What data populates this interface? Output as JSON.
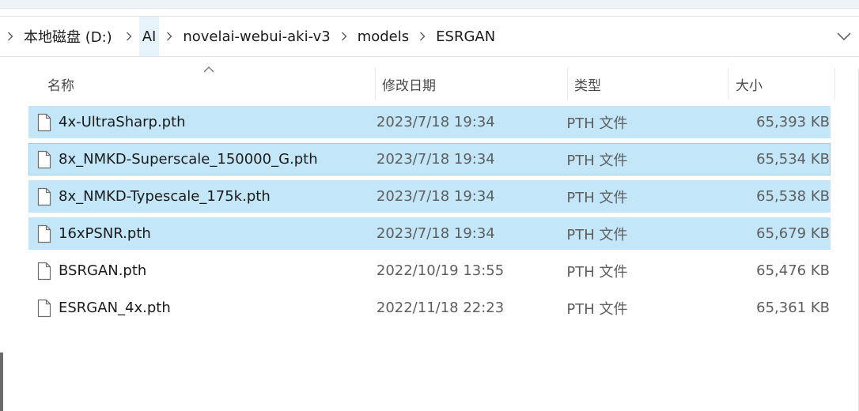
{
  "breadcrumb": {
    "items": [
      {
        "label": "本地磁盘 (D:)"
      },
      {
        "label": "AI"
      },
      {
        "label": "novelai-webui-aki-v3"
      },
      {
        "label": "models"
      },
      {
        "label": "ESRGAN"
      }
    ],
    "separator_icon": "chevron-right-icon",
    "dropdown_icon": "chevron-down-icon"
  },
  "columns": {
    "name": "名称",
    "date": "修改日期",
    "type": "类型",
    "size": "大小",
    "sort_icon": "sort-ascending-icon"
  },
  "files": [
    {
      "name": "4x-UltraSharp.pth",
      "date": "2023/7/18 19:34",
      "type": "PTH 文件",
      "size": "65,393 KB",
      "selected": true,
      "focused": false
    },
    {
      "name": "8x_NMKD-Superscale_150000_G.pth",
      "date": "2023/7/18 19:34",
      "type": "PTH 文件",
      "size": "65,534 KB",
      "selected": true,
      "focused": true
    },
    {
      "name": "8x_NMKD-Typescale_175k.pth",
      "date": "2023/7/18 19:34",
      "type": "PTH 文件",
      "size": "65,538 KB",
      "selected": true,
      "focused": false
    },
    {
      "name": "16xPSNR.pth",
      "date": "2023/7/18 19:34",
      "type": "PTH 文件",
      "size": "65,679 KB",
      "selected": true,
      "focused": false
    },
    {
      "name": "BSRGAN.pth",
      "date": "2022/10/19 13:55",
      "type": "PTH 文件",
      "size": "65,476 KB",
      "selected": false,
      "focused": false
    },
    {
      "name": "ESRGAN_4x.pth",
      "date": "2022/11/18 22:23",
      "type": "PTH 文件",
      "size": "65,361 KB",
      "selected": false,
      "focused": false
    }
  ],
  "colors": {
    "selection": "#c3e7f8",
    "focus_border": "#9ccde9",
    "breadcrumb_highlight": "#e6f3fb"
  }
}
